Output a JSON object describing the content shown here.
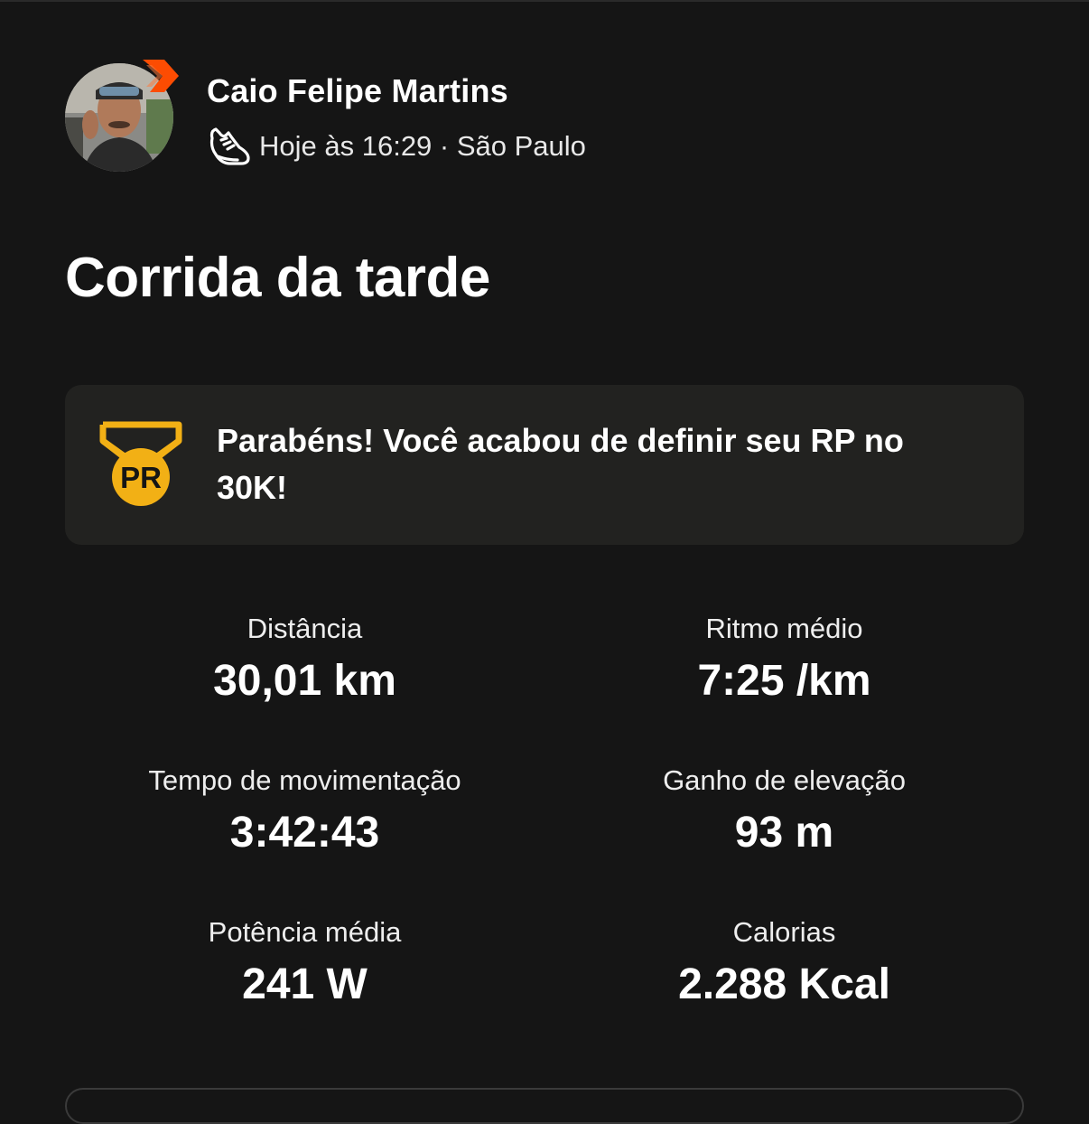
{
  "athlete": {
    "name": "Caio Felipe Martins",
    "meta": "Hoje às 16:29 · São Paulo"
  },
  "activity": {
    "title": "Corrida da tarde"
  },
  "achievement": {
    "badge": "PR",
    "text": "Parabéns! Você acabou de definir seu RP no 30K!"
  },
  "stats": [
    {
      "label": "Distância",
      "value": "30,01 km"
    },
    {
      "label": "Ritmo médio",
      "value": "7:25 /km"
    },
    {
      "label": "Tempo de movimentação",
      "value": "3:42:43"
    },
    {
      "label": "Ganho de elevação",
      "value": "93 m"
    },
    {
      "label": "Potência média",
      "value": "241 W"
    },
    {
      "label": "Calorias",
      "value": "2.288 Kcal"
    }
  ],
  "colors": {
    "background": "#151515",
    "card": "#222220",
    "brand_orange": "#fc4c02",
    "pr_gold": "#f2b015"
  },
  "icons": {
    "subscriber_badge": "strava-chevron-icon",
    "activity_type": "running-shoe-icon",
    "pr_medal": "pr-medal-icon"
  }
}
